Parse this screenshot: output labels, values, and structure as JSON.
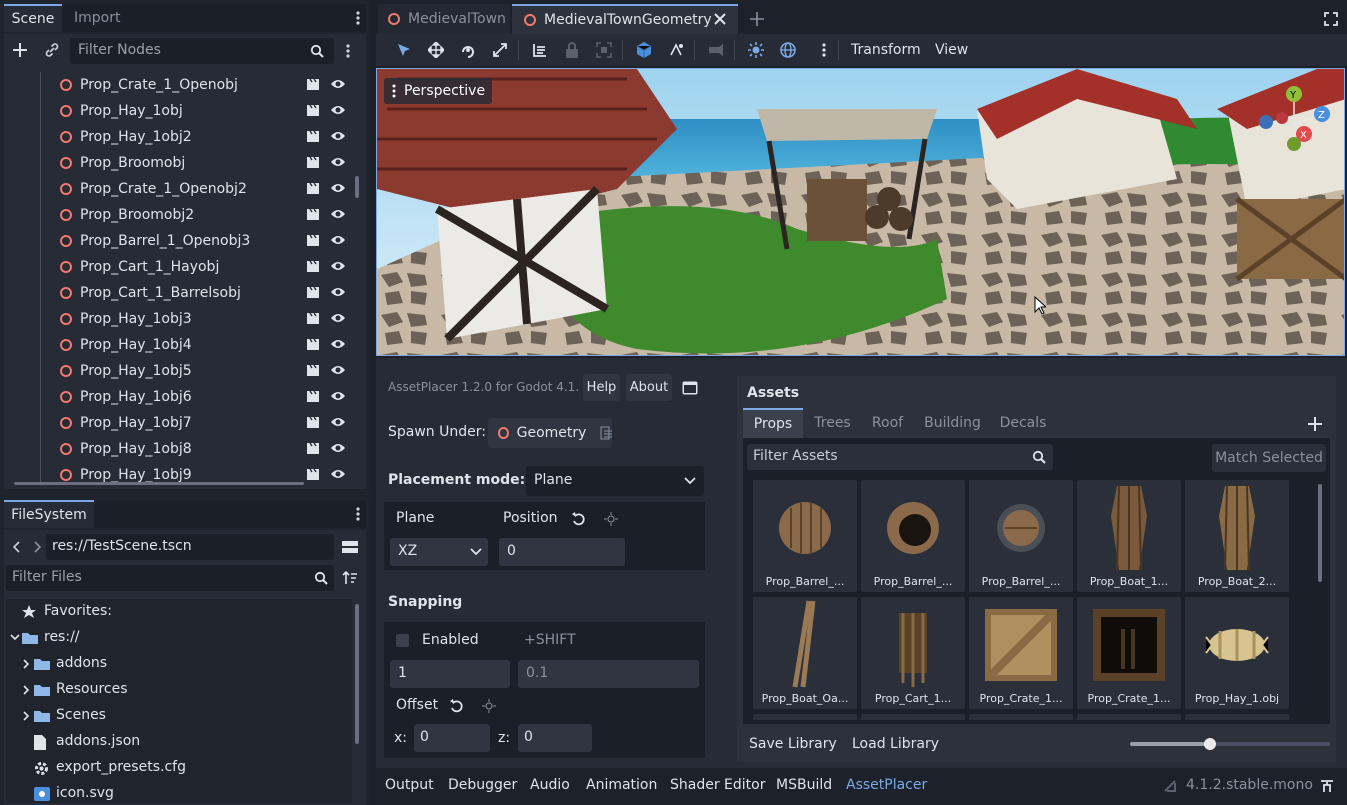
{
  "scene_dock": {
    "tabs": [
      "Scene",
      "Import"
    ],
    "filter_placeholder": "Filter Nodes",
    "nodes": [
      "Prop_Crate_1_Openobj",
      "Prop_Hay_1obj",
      "Prop_Hay_1obj2",
      "Prop_Broomobj",
      "Prop_Crate_1_Openobj2",
      "Prop_Broomobj2",
      "Prop_Barrel_1_Openobj3",
      "Prop_Cart_1_Hayobj",
      "Prop_Cart_1_Barrelsobj",
      "Prop_Hay_1obj3",
      "Prop_Hay_1obj4",
      "Prop_Hay_1obj5",
      "Prop_Hay_1obj6",
      "Prop_Hay_1obj7",
      "Prop_Hay_1obj8",
      "Prop_Hay_1obj9"
    ]
  },
  "filesystem": {
    "tab": "FileSystem",
    "path": "res://TestScene.tscn",
    "filter_placeholder": "Filter Files",
    "items": [
      {
        "label": "Favorites:",
        "icon": "star-icon",
        "indent": 0
      },
      {
        "label": "res://",
        "icon": "folder-icon",
        "indent": 0
      },
      {
        "label": "addons",
        "icon": "folder-icon",
        "indent": 1
      },
      {
        "label": "Resources",
        "icon": "folder-icon",
        "indent": 1
      },
      {
        "label": "Scenes",
        "icon": "folder-icon",
        "indent": 1
      },
      {
        "label": "addons.json",
        "icon": "file-icon",
        "indent": 1
      },
      {
        "label": "export_presets.cfg",
        "icon": "gear-icon",
        "indent": 1
      },
      {
        "label": "icon.svg",
        "icon": "image-icon",
        "indent": 1
      }
    ]
  },
  "editor_tabs": [
    "MedievalTown",
    "MedievalTownGeometry"
  ],
  "toolbar": {
    "transform": "Transform",
    "view": "View"
  },
  "viewport": {
    "label": "Perspective"
  },
  "assetplacer": {
    "version": "AssetPlacer 1.2.0 for Godot 4.1.",
    "help": "Help",
    "about": "About",
    "spawn_under_label": "Spawn Under:",
    "spawn_under_value": "Geometry",
    "placement_mode_label": "Placement mode:",
    "placement_mode_value": "Plane",
    "plane_label": "Plane",
    "position_label": "Position",
    "plane_value": "XZ",
    "position_value": "0",
    "snapping_label": "Snapping",
    "enabled_label": "Enabled",
    "shift_label": "+SHIFT",
    "snap_value": "1",
    "snap_shift_value": "0.1",
    "offset_label": "Offset",
    "x_label": "x:",
    "x_value": "0",
    "z_label": "z:",
    "z_value": "0"
  },
  "assets": {
    "title": "Assets",
    "tabs": [
      "Props",
      "Trees",
      "Roof",
      "Building",
      "Decals"
    ],
    "filter_placeholder": "Filter Assets",
    "match_selected": "Match Selected",
    "items": [
      "Prop_Barrel_...",
      "Prop_Barrel_...",
      "Prop_Barrel_...",
      "Prop_Boat_1...",
      "Prop_Boat_2...",
      "Prop_Boat_Oa...",
      "Prop_Cart_1...",
      "Prop_Crate_1...",
      "Prop_Crate_1...",
      "Prop_Hay_1.obj"
    ],
    "save_library": "Save Library",
    "load_library": "Load Library",
    "zoom_level": 0.4
  },
  "bottom_panel": {
    "tabs": [
      "Output",
      "Debugger",
      "Audio",
      "Animation",
      "Shader Editor",
      "MSBuild",
      "AssetPlacer"
    ],
    "version": "4.1.2.stable.mono"
  },
  "colors": {
    "accent": "#7aa9e6",
    "node_icon": "#f07a6e",
    "folder": "#8fb8e8"
  }
}
